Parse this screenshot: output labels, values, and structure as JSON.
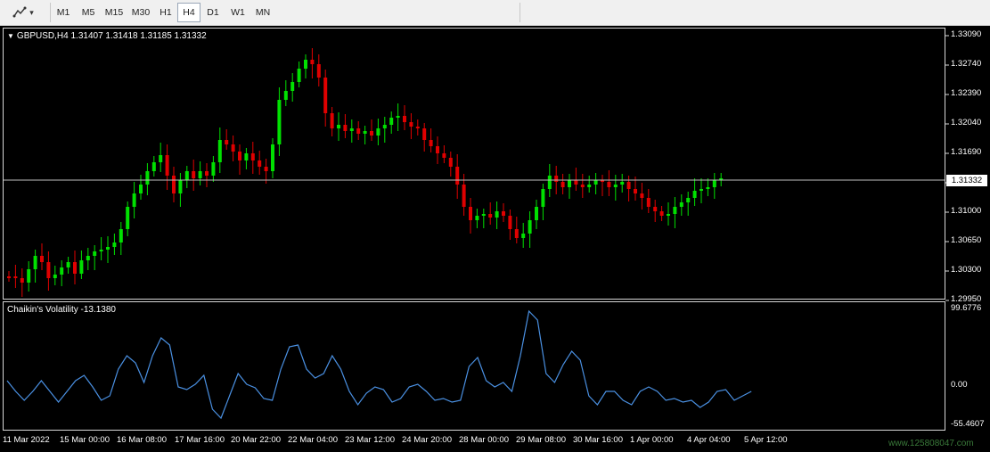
{
  "toolbar": {
    "tool_icon": "line-tools-icon",
    "tool_dropdown": "▾",
    "timeframes": [
      "M1",
      "M5",
      "M15",
      "M30",
      "H1",
      "H4",
      "D1",
      "W1",
      "MN"
    ],
    "active_timeframe": "H4"
  },
  "main": {
    "legend": "GBPUSD,H4  1.31407 1.31418 1.31185 1.31332",
    "current_price": "1.31332",
    "price_labels": [
      "1.33090",
      "1.32740",
      "1.32390",
      "1.32040",
      "1.31690",
      "1.31000",
      "1.30650",
      "1.30300",
      "1.29950"
    ]
  },
  "indicator": {
    "legend": "Chaikin's Volatility -13.1380",
    "scale_labels": [
      "99.6776",
      "0.00",
      "-55.4607"
    ],
    "line_color": "#4a90e2"
  },
  "time_labels": [
    "11 Mar 2022",
    "15 Mar 00:00",
    "16 Mar 08:00",
    "17 Mar 16:00",
    "20 Mar 22:00",
    "22 Mar 04:00",
    "23 Mar 12:00",
    "24 Mar 20:00",
    "28 Mar 00:00",
    "29 Mar 08:00",
    "30 Mar 16:00",
    "1 Apr 00:00",
    "4 Apr 04:00",
    "5 Apr 12:00"
  ],
  "watermark": "www.125808047.com",
  "colors": {
    "bull": "#00e000",
    "bear": "#e00000",
    "background": "#000000",
    "grid_line": "#c0c0c0"
  }
}
